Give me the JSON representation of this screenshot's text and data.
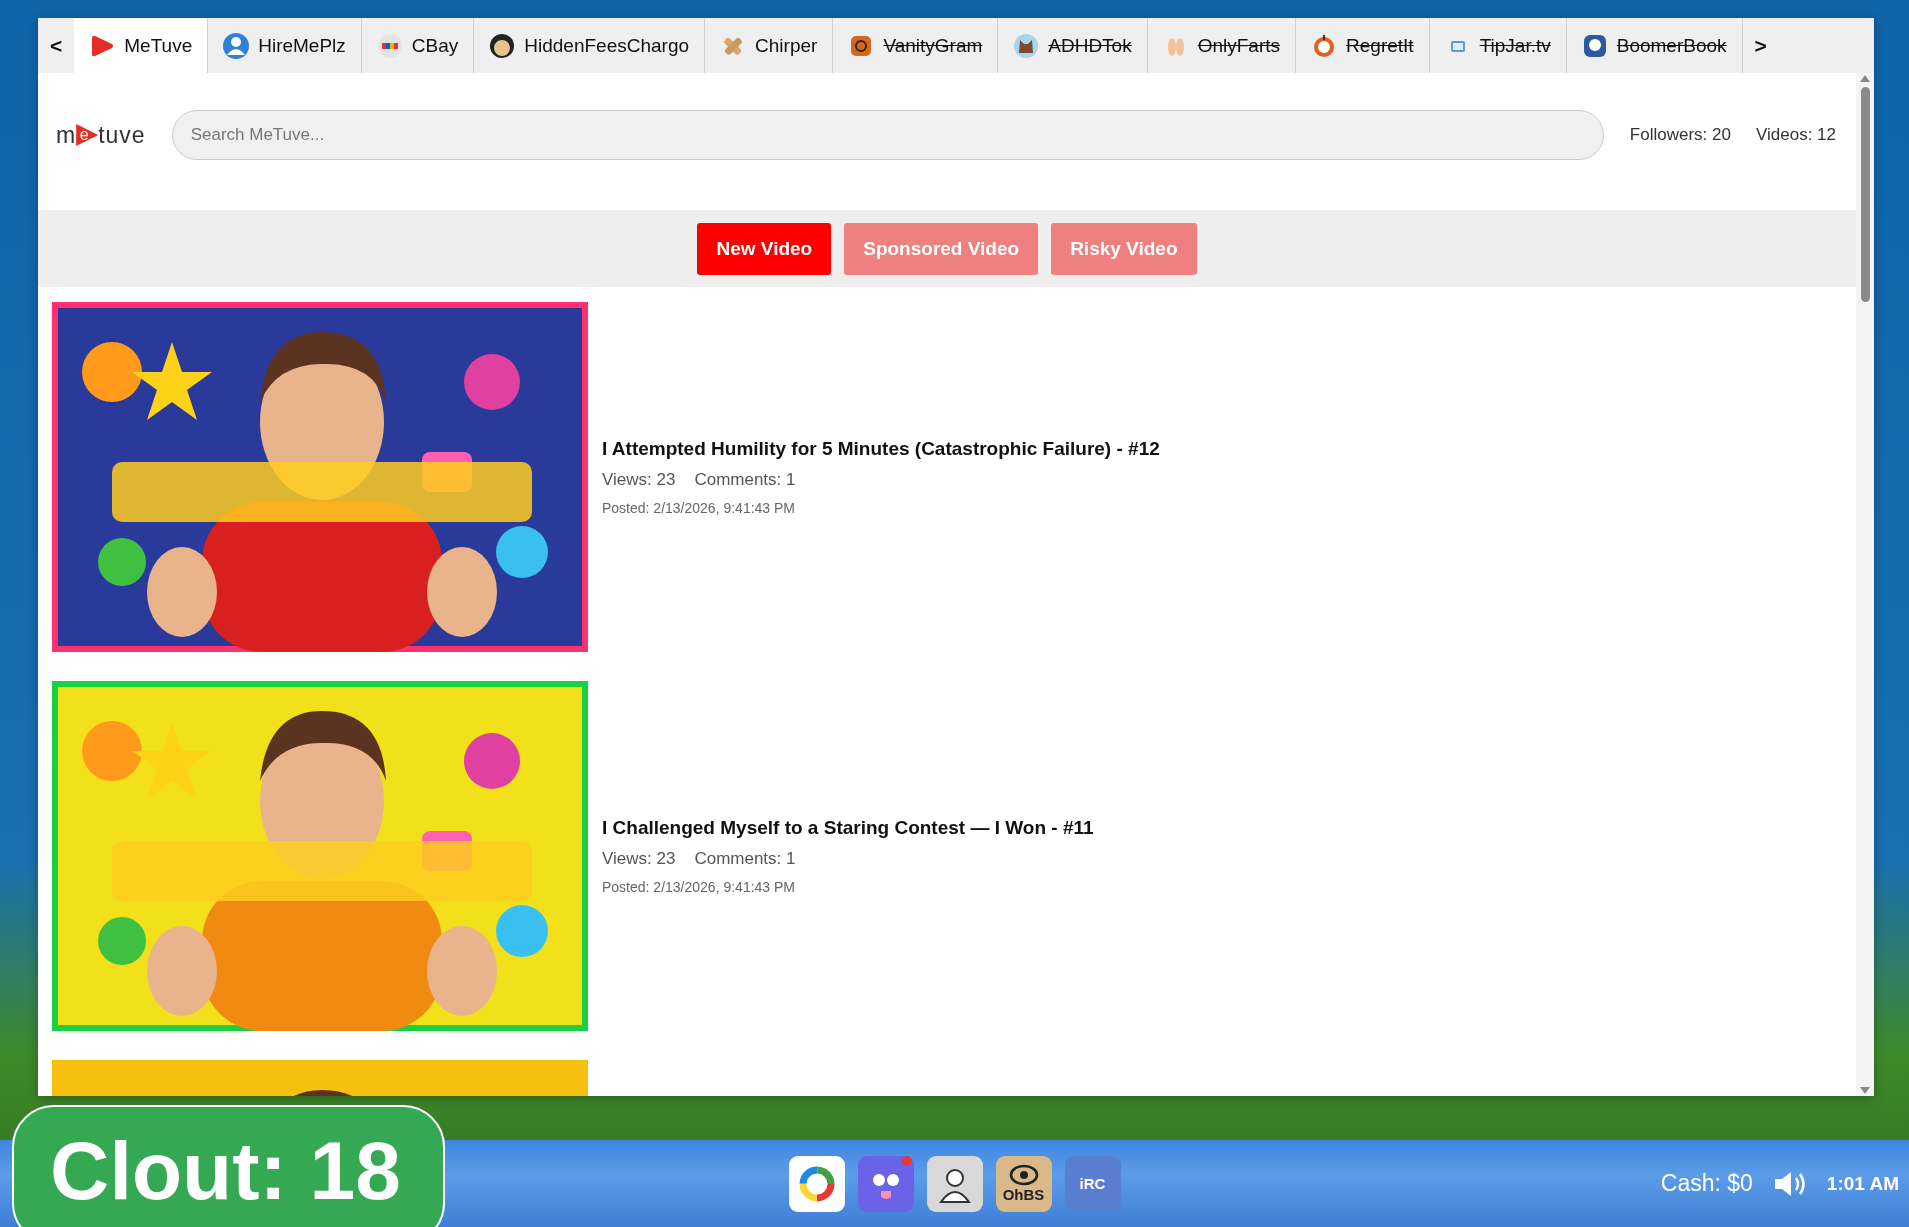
{
  "browser": {
    "prev": "<",
    "next": ">",
    "tabs": [
      {
        "label": "MeTuve",
        "selected": true,
        "struck": false
      },
      {
        "label": "HireMePlz",
        "selected": false,
        "struck": false
      },
      {
        "label": "CBay",
        "selected": false,
        "struck": false
      },
      {
        "label": "HiddenFeesChargo",
        "selected": false,
        "struck": false
      },
      {
        "label": "Chirper",
        "selected": false,
        "struck": false
      },
      {
        "label": "VanityGram",
        "selected": false,
        "struck": true
      },
      {
        "label": "ADHDTok",
        "selected": false,
        "struck": true
      },
      {
        "label": "OnlyFarts",
        "selected": false,
        "struck": true
      },
      {
        "label": "RegretIt",
        "selected": false,
        "struck": true
      },
      {
        "label": "TipJar.tv",
        "selected": false,
        "struck": true
      },
      {
        "label": "BoomerBook",
        "selected": false,
        "struck": true
      }
    ]
  },
  "site": {
    "logo": {
      "before": "m",
      "mark": "e",
      "after": "tuve"
    },
    "search": {
      "placeholder": "Search MeTuve..."
    },
    "stats": [
      "Followers: 20",
      "Videos: 12"
    ],
    "actions": [
      {
        "label": "New Video",
        "disabled": false
      },
      {
        "label": "Sponsored Video",
        "disabled": true
      },
      {
        "label": "Risky Video",
        "disabled": true
      }
    ],
    "videos": [
      {
        "kind": "full",
        "title": "I Attempted Humility for 5 Minutes (Catastrophic Failure) - #12",
        "views": "Views: 23",
        "comments": "Comments: 1",
        "posted": "Posted: 2/13/2026, 9:41:43 PM"
      },
      {
        "kind": "full",
        "title": "I Challenged Myself to a Staring Contest — I Won - #11",
        "views": "Views: 23",
        "comments": "Comments: 1",
        "posted": "Posted: 2/13/2026, 9:41:43 PM"
      },
      {
        "kind": "partial"
      }
    ]
  },
  "clout": "Clout: 18",
  "taskbar": {
    "apps": [
      {
        "kind": "ring",
        "notify": false
      },
      {
        "kind": "robot",
        "notify": true
      },
      {
        "kind": "person",
        "notify": false
      },
      {
        "kind": "eye",
        "label": "OhBS",
        "notify": false
      },
      {
        "kind": "irc",
        "label": "iRC",
        "notify": false
      }
    ],
    "cash": "Cash: $0",
    "time": "1:01 AM"
  }
}
